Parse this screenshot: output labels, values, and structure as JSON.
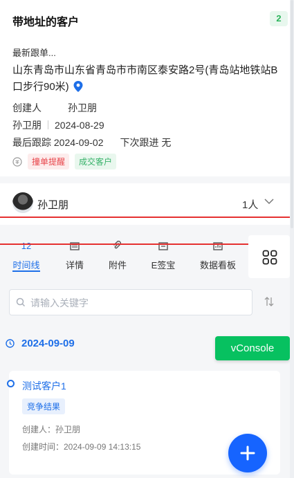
{
  "header": {
    "title": "带地址的客户",
    "count_badge": "2"
  },
  "customer": {
    "follow_preview": "最新跟单...",
    "address": "山东青岛市山东省青岛市市南区泰安路2号(青岛站地铁站B口步行90米)",
    "creator_label": "创建人",
    "creator_name": "孙卫朋",
    "owner": "孙卫朋",
    "created_date": "2024-08-29",
    "last_follow_label": "最后跟踪",
    "last_follow_date": "2024-09-02",
    "next_follow_label": "下次跟进",
    "next_follow_value": "无",
    "tags": [
      "撞单提醒",
      "成交客户"
    ],
    "tag_colors": {
      "alert": "#e8464b",
      "deal": "#38b26a"
    }
  },
  "team": {
    "owner_name": "孙卫朋",
    "member_count": "1人"
  },
  "tabs": {
    "timeline_count": "12",
    "items": [
      {
        "label": "时间线",
        "icon": "timeline-count"
      },
      {
        "label": "详情",
        "icon": "details-icon"
      },
      {
        "label": "附件",
        "icon": "paperclip-icon"
      },
      {
        "label": "E签宝",
        "icon": "esign-icon"
      },
      {
        "label": "数据看板",
        "icon": "dashboard-icon"
      }
    ],
    "grid_icon": "grid-icon"
  },
  "search": {
    "placeholder": "请输入关键字",
    "sort_icon": "sort-icon"
  },
  "timeline": {
    "date": "2024-09-09",
    "record": {
      "title": "测试客户1",
      "tag": "竞争结果",
      "creator_line": "创建人：孙卫朋",
      "created_time_line": "创建时间：2024-09-09 14:13:15"
    }
  },
  "debug": {
    "vconsole_label": "vConsole"
  },
  "fab": {
    "icon": "plus-icon"
  },
  "colors": {
    "accent": "#1e6fe8",
    "vconsole": "#07c160",
    "annotation_line": "#e53030"
  }
}
